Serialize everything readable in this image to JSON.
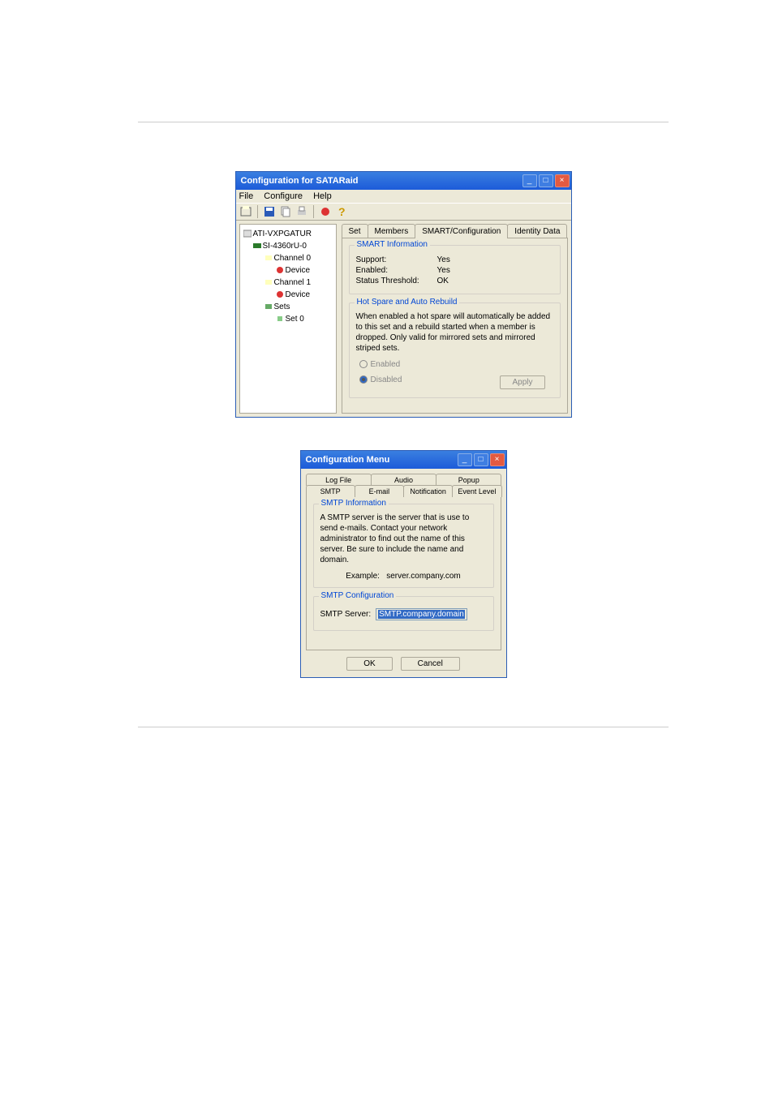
{
  "win1": {
    "title": "Configuration for SATARaid",
    "menu": {
      "file": "File",
      "configure": "Configure",
      "help": "Help"
    },
    "tree": {
      "root": "ATI-VXPGATUR",
      "ctrl": "SI-4360rU-0",
      "ch0": "Channel 0",
      "dev0": "Device",
      "ch1": "Channel 1",
      "dev1": "Device",
      "sets": "Sets",
      "set0": "Set 0"
    },
    "tabs": {
      "set": "Set",
      "members": "Members",
      "smart": "SMART/Configuration",
      "identity": "Identity Data"
    },
    "smart": {
      "legend": "SMART Information",
      "support_k": "Support:",
      "support_v": "Yes",
      "enabled_k": "Enabled:",
      "enabled_v": "Yes",
      "thresh_k": "Status Threshold:",
      "thresh_v": "OK"
    },
    "hot": {
      "legend": "Hot Spare and Auto Rebuild",
      "desc": "When enabled a hot spare will automatically be added to this set and a rebuild started when a member is dropped. Only valid for mirrored sets and mirrored striped sets.",
      "enabled": "Enabled",
      "disabled": "Disabled",
      "apply": "Apply"
    }
  },
  "win2": {
    "title": "Configuration Menu",
    "tabs": {
      "logfile": "Log File",
      "audio": "Audio",
      "popup": "Popup",
      "smtp": "SMTP",
      "email": "E-mail",
      "notification": "Notification",
      "eventlevel": "Event Level"
    },
    "info": {
      "legend": "SMTP Information",
      "text": "A SMTP server is the server that is use to send e-mails. Contact your network administrator to find out the name of this server. Be sure to include the name and domain.",
      "example_lbl": "Example:",
      "example_val": "server.company.com"
    },
    "cfg": {
      "legend": "SMTP Configuration",
      "server_lbl": "SMTP Server:",
      "server_val": "SMTP.company.domain"
    },
    "ok": "OK",
    "cancel": "Cancel"
  }
}
